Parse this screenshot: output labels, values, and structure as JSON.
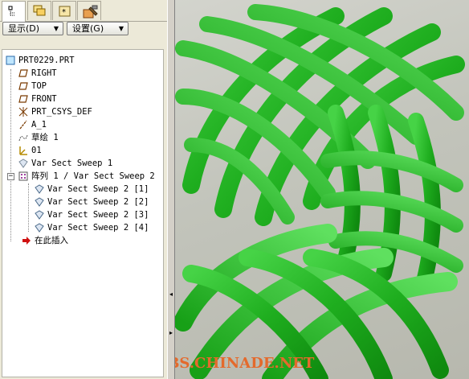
{
  "tabs": [
    {
      "icon": "tree-icon"
    },
    {
      "icon": "layers-icon"
    },
    {
      "icon": "favorites-icon"
    },
    {
      "icon": "tools-icon"
    }
  ],
  "menus": {
    "show_label": "显示(D)",
    "settings_label": "设置(G)"
  },
  "tree": {
    "root": "PRT0229.PRT",
    "items": [
      {
        "label": "RIGHT",
        "icon": "datum-plane-icon"
      },
      {
        "label": "TOP",
        "icon": "datum-plane-icon"
      },
      {
        "label": "FRONT",
        "icon": "datum-plane-icon"
      },
      {
        "label": "PRT_CSYS_DEF",
        "icon": "coordinate-system-icon"
      },
      {
        "label": "A_1",
        "icon": "datum-axis-icon"
      },
      {
        "label": "草绘 1",
        "icon": "sketch-icon"
      },
      {
        "label": "01",
        "icon": "csys-icon"
      },
      {
        "label": "Var Sect Sweep 1",
        "icon": "sweep-icon"
      },
      {
        "label": "阵列 1 / Var Sect Sweep 2",
        "icon": "pattern-icon"
      },
      {
        "label": "Var Sect Sweep 2 [1]",
        "icon": "sweep-icon"
      },
      {
        "label": "Var Sect Sweep 2 [2]",
        "icon": "sweep-icon"
      },
      {
        "label": "Var Sect Sweep 2 [3]",
        "icon": "sweep-icon"
      },
      {
        "label": "Var Sect Sweep 2 [4]",
        "icon": "sweep-icon"
      },
      {
        "label": "在此插入",
        "icon": "insert-here-arrow-icon"
      }
    ]
  },
  "watermark": "BBS.CHINADE.NET",
  "colors": {
    "model_green": "#1fae1f",
    "model_highlight": "#55e055",
    "insert_arrow": "#d01010",
    "watermark": "#e46a2c"
  }
}
